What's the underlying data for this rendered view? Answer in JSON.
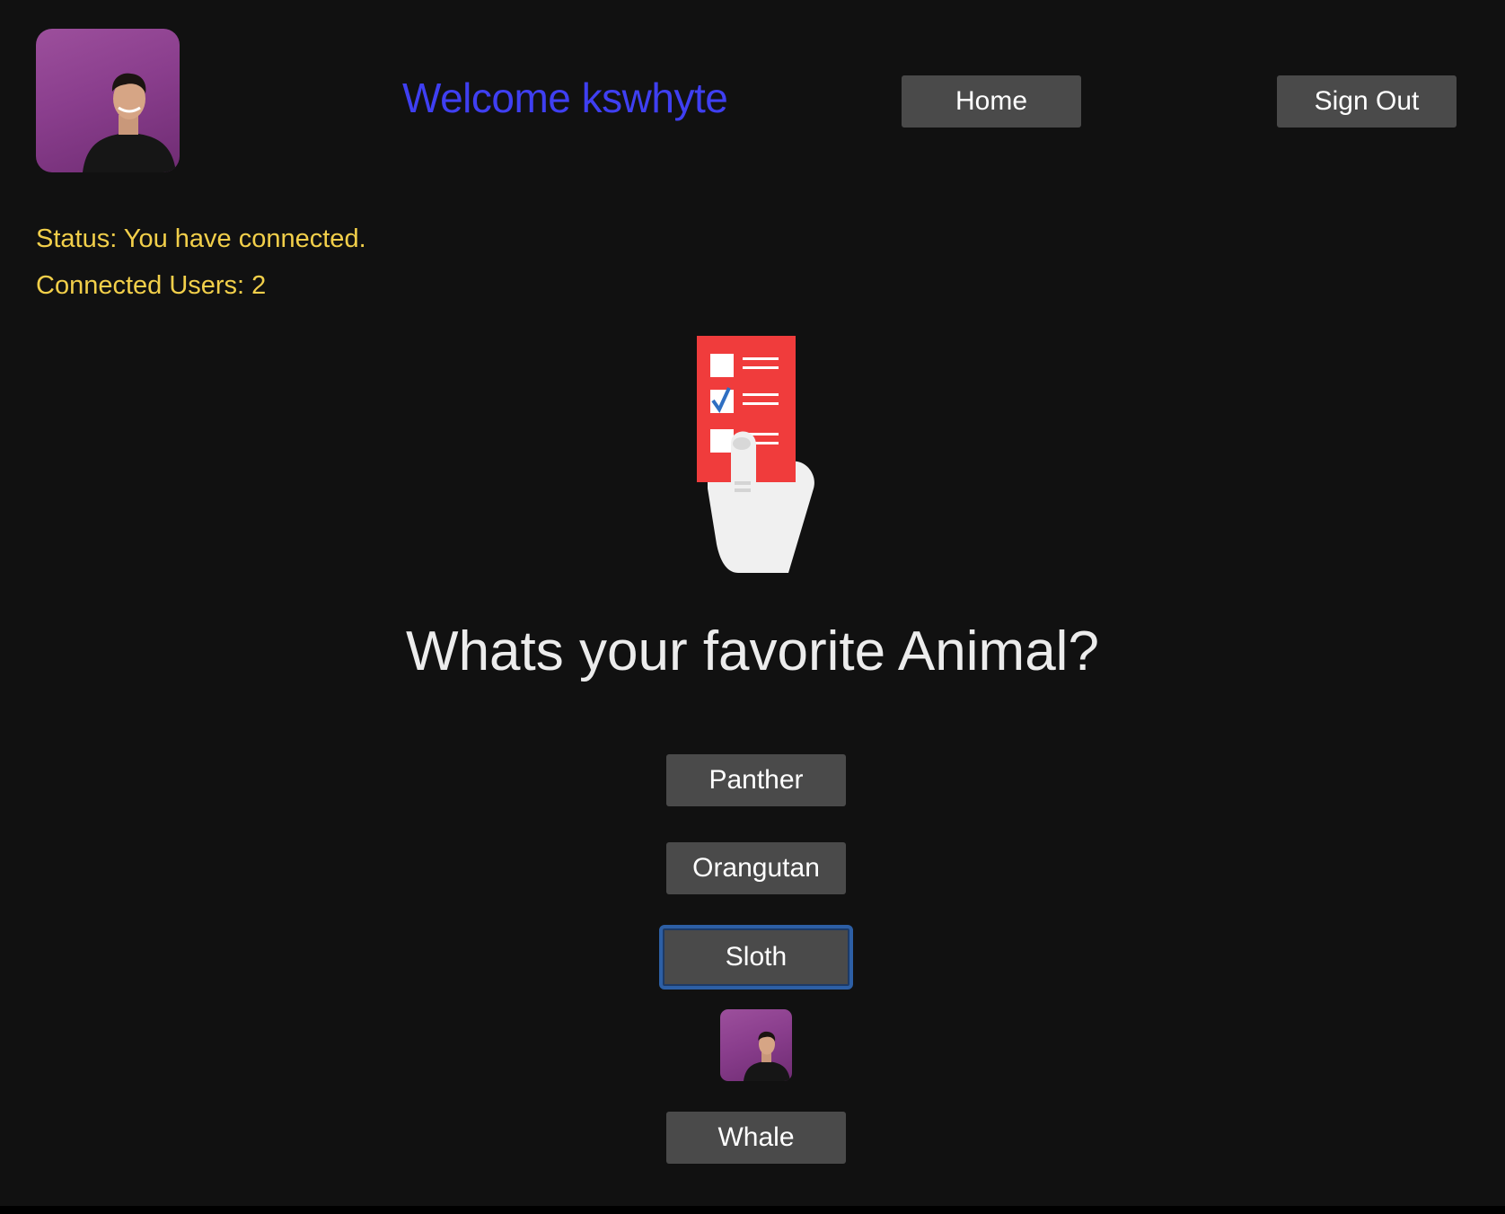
{
  "header": {
    "avatar_icon": "user-avatar",
    "welcome_text": "Welcome kswhyte",
    "home_label": "Home",
    "signout_label": "Sign Out"
  },
  "status": {
    "status_text": "Status: You have connected.",
    "users_prefix": "Connected Users: ",
    "users_count": "2"
  },
  "poll": {
    "illustration_icon": "ballot-hand-icon",
    "question": "Whats your favorite Animal?",
    "options": [
      {
        "label": "Panther"
      },
      {
        "label": "Orangutan"
      },
      {
        "label": "Sloth",
        "focused": true
      },
      {
        "label": "Whale"
      }
    ],
    "voter_avatar_icon": "user-avatar"
  },
  "colors": {
    "background": "#111111",
    "welcome": "#3f3ff2",
    "status_text": "#f2cf4a",
    "button_bg": "#4a4a4a",
    "focus_ring": "#2d5fa5",
    "ballot_red": "#f03c3c"
  }
}
